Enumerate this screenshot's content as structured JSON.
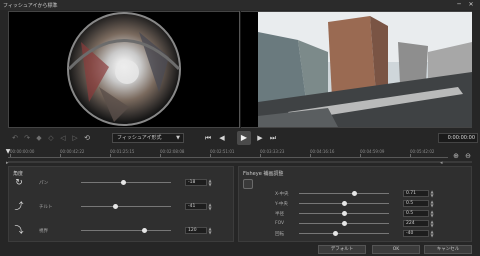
{
  "window": {
    "title": "フィッシュアイから標準",
    "minimize_glyph": "─",
    "close_glyph": "✕"
  },
  "preview": {
    "left_label": "fisheye source frame",
    "right_label": "corrected standard frame"
  },
  "controls": {
    "projection_mode": "フィッシュアイ形式",
    "timecode": "0:00:00:00"
  },
  "timeline": {
    "ticks": [
      "00:00:00:00",
      "00:00:42:22",
      "00:01:25:15",
      "00:02:08:08",
      "00:02:51:01",
      "00:03:33:23",
      "00:04:16:16",
      "00:04:59:09",
      "00:05:42:02",
      "00:06:24:25"
    ]
  },
  "left_panel": {
    "title": "角度",
    "params": [
      {
        "label": "パン",
        "value": "-18",
        "level": 0.47
      },
      {
        "label": "チルト",
        "value": "-41",
        "level": 0.38
      },
      {
        "label": "視界",
        "value": "120",
        "level": 0.7
      }
    ]
  },
  "right_panel": {
    "title": "Fisheye 補画調整",
    "params": [
      {
        "label": "X-中央",
        "value": "0.71",
        "level": 0.62
      },
      {
        "label": "Y-中央",
        "value": "0.5",
        "level": 0.5
      },
      {
        "label": "半径",
        "value": "0.5",
        "level": 0.5
      },
      {
        "label": "FOV",
        "value": "224",
        "level": 0.5
      },
      {
        "label": "回転",
        "value": "-40",
        "level": 0.4
      }
    ]
  },
  "footer": {
    "default_label": "デフォルト",
    "ok_label": "OK",
    "cancel_label": "キャンセル"
  }
}
